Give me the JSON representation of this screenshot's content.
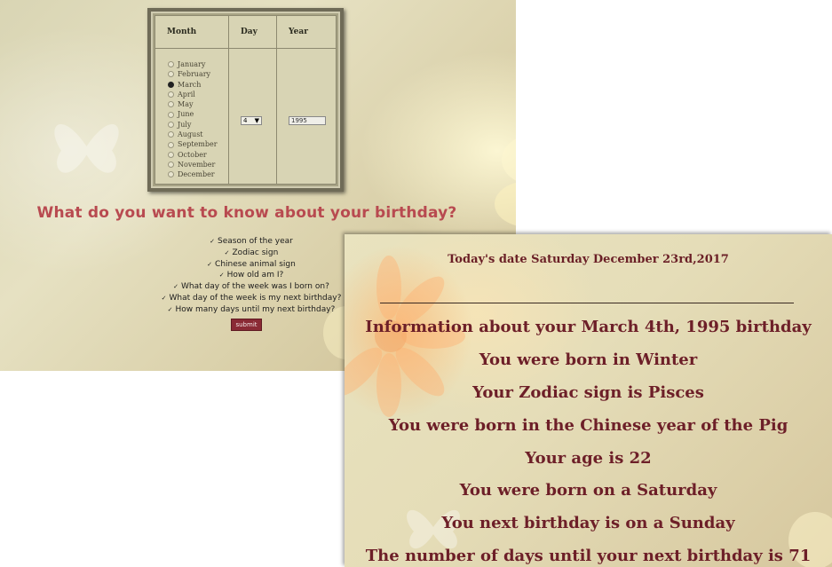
{
  "form": {
    "table": {
      "month_header": "Month",
      "day_header": "Day",
      "year_header": "Year",
      "months": [
        "January",
        "February",
        "March",
        "April",
        "May",
        "June",
        "July",
        "August",
        "September",
        "October",
        "November",
        "December"
      ],
      "selected_month": "March",
      "day_value": "4",
      "year_value": "1995"
    },
    "question": "What do you want to know about your birthday?",
    "options": [
      "Season of the year",
      "Zodiac sign",
      "Chinese animal sign",
      "How old am I?",
      "What day of the week was I born on?",
      "What day of the week is my next birthday?",
      "How many days until my next birthday?"
    ],
    "submit_label": "submit"
  },
  "results": {
    "today": "Today's date Saturday December 23rd,2017",
    "lines": [
      "Information about your March 4th, 1995 birthday",
      "You were born in Winter",
      "Your Zodiac sign is Pisces",
      "You were born in the Chinese year of the Pig",
      "Your age is 22",
      "You were born on a Saturday",
      "You next birthday is on a Sunday",
      "The number of days until your next birthday is 71"
    ]
  },
  "colors": {
    "heading_red": "#b84a50",
    "result_text": "#6d1f28",
    "submit_bg": "#8a2a35"
  },
  "icons": {
    "check": "checkmark-icon",
    "dropdown": "chevron-down-icon"
  }
}
